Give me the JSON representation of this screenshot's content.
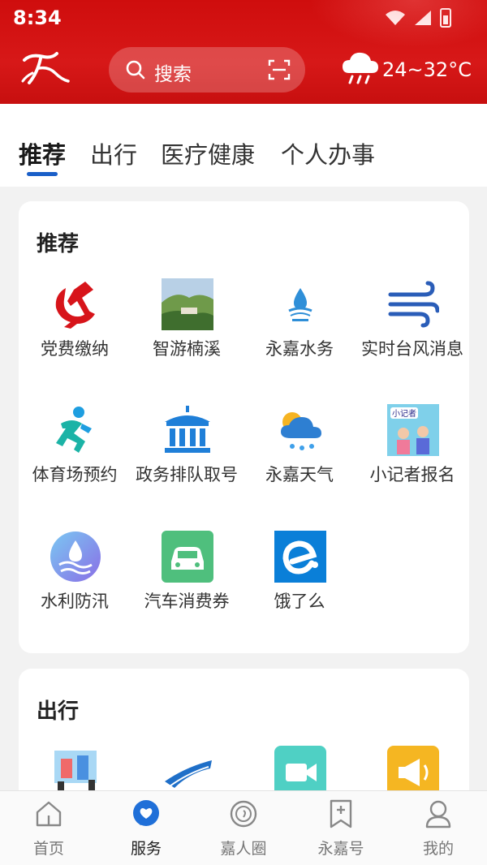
{
  "status": {
    "time": "8:34"
  },
  "header": {
    "search_placeholder": "搜索",
    "temperature": "24~32°C",
    "accent_color": "#d71818"
  },
  "tabs": [
    {
      "label": "推荐",
      "active": true
    },
    {
      "label": "出行"
    },
    {
      "label": "医疗健康"
    },
    {
      "label": "个人办事"
    }
  ],
  "sections": [
    {
      "title": "推荐",
      "items": [
        {
          "label": "党费缴纳",
          "icon": "party-emblem-icon"
        },
        {
          "label": "智游楠溪",
          "icon": "landscape-photo-icon"
        },
        {
          "label": "永嘉水务",
          "icon": "water-drop-logo-icon"
        },
        {
          "label": "实时台风消息",
          "icon": "wind-icon"
        },
        {
          "label": "体育场预约",
          "icon": "running-person-icon"
        },
        {
          "label": "政务排队取号",
          "icon": "government-building-icon"
        },
        {
          "label": "永嘉天气",
          "icon": "weather-sun-cloud-icon"
        },
        {
          "label": "小记者报名",
          "icon": "reporter-poster-icon",
          "image_text": "小记者"
        },
        {
          "label": "水利防汛",
          "icon": "water-wave-icon"
        },
        {
          "label": "汽车消费券",
          "icon": "car-icon"
        },
        {
          "label": "饿了么",
          "icon": "eleme-logo-icon"
        }
      ]
    },
    {
      "title": "出行",
      "items": [
        {
          "label": "",
          "icon": "travel-illustration-icon"
        },
        {
          "label": "",
          "icon": "highway-icon"
        },
        {
          "label": "",
          "icon": "video-camera-icon"
        },
        {
          "label": "",
          "icon": "megaphone-icon"
        }
      ]
    }
  ],
  "bottom_nav": [
    {
      "label": "首页",
      "icon": "home-icon"
    },
    {
      "label": "服务",
      "icon": "heart-chat-icon",
      "active": true
    },
    {
      "label": "嘉人圈",
      "icon": "circle-swirl-icon"
    },
    {
      "label": "永嘉号",
      "icon": "bookmark-plus-icon"
    },
    {
      "label": "我的",
      "icon": "user-icon"
    }
  ]
}
